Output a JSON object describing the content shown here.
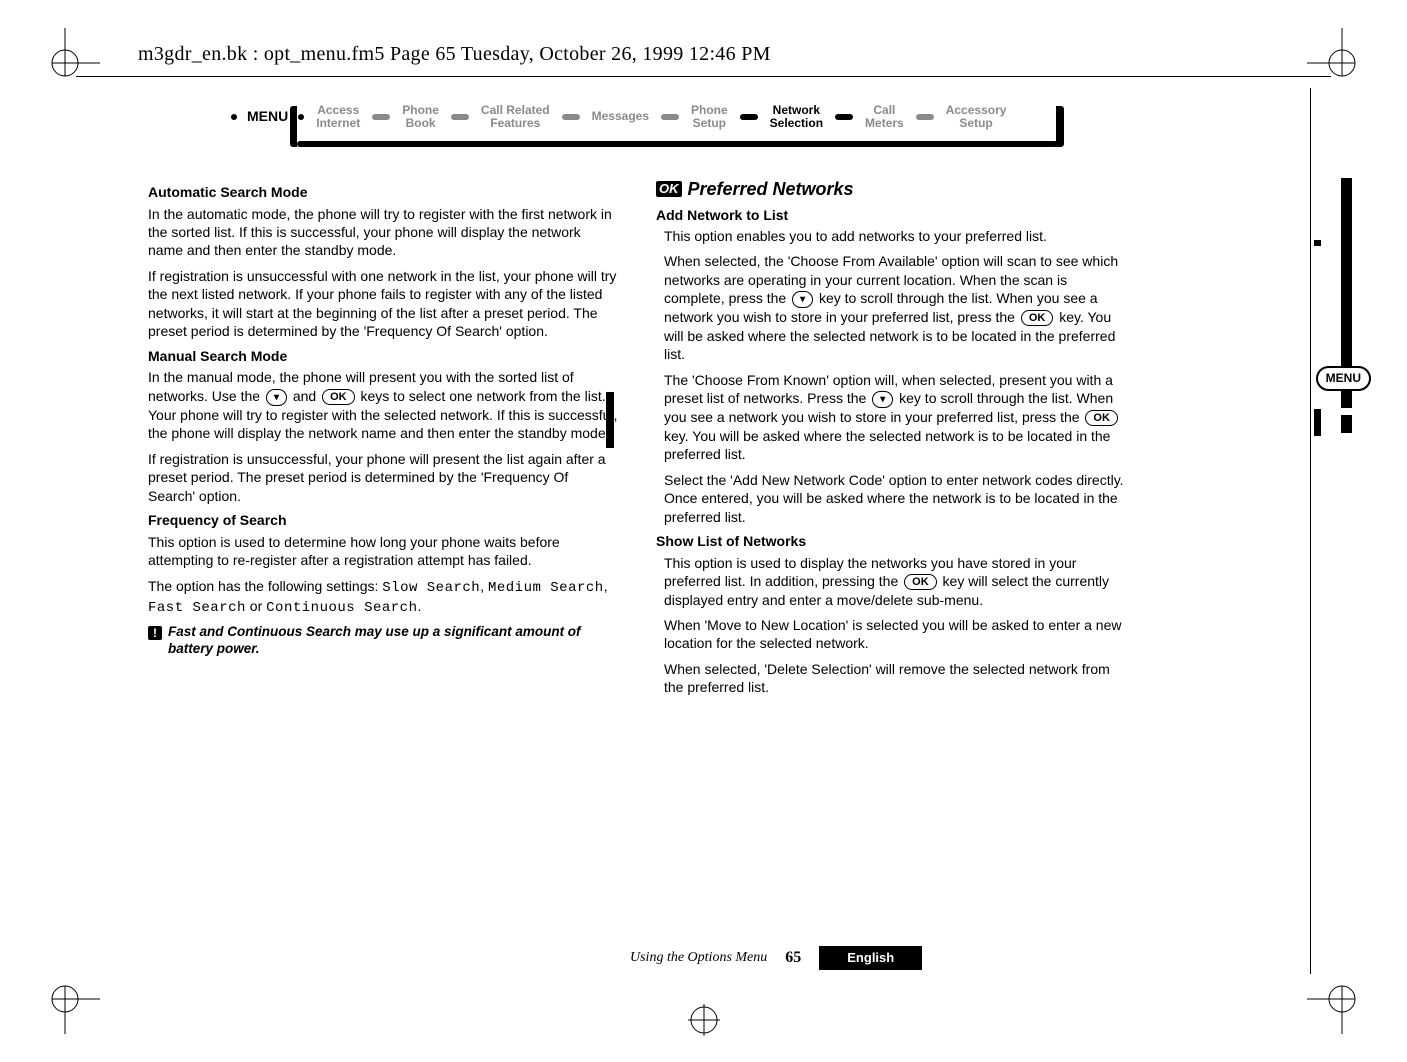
{
  "print_header": "m3gdr_en.bk : opt_menu.fm5  Page 65  Tuesday, October 26, 1999  12:46 PM",
  "nav": {
    "menu_label": "MENU",
    "items": [
      {
        "top": "Access",
        "bot": "Internet"
      },
      {
        "top": "Phone",
        "bot": "Book"
      },
      {
        "top": "Call Related",
        "bot": "Features"
      },
      {
        "top": "Messages",
        "bot": ""
      },
      {
        "top": "Phone",
        "bot": "Setup"
      },
      {
        "top": "Network",
        "bot": "Selection"
      },
      {
        "top": "Call",
        "bot": "Meters"
      },
      {
        "top": "Accessory",
        "bot": "Setup"
      }
    ],
    "active_index": 5
  },
  "left": {
    "h_auto": "Automatic Search Mode",
    "auto_p1": "In the automatic mode, the phone will try to register with the first network in the sorted list. If this is successful, your phone will display the network name and then enter the standby mode.",
    "auto_p2": "If registration is unsuccessful with one network in the list, your phone will try the next listed network. If your phone fails to register with any of the listed networks, it will start at the beginning of the list after a preset period. The preset period is determined by the 'Frequency Of Search' option.",
    "h_manual": "Manual Search Mode",
    "manual_p1a": "In the manual mode, the phone will present you with the sorted list of networks. Use the ",
    "manual_p1b": " and ",
    "manual_p1c": " keys to select one network from the list. Your phone will try to register with the selected network. If this is successful, the phone will display the network name and then enter the standby mode.",
    "manual_p2": "If registration is unsuccessful, your phone will present the list again after a preset period. The preset period is determined by the 'Frequency Of Search' option.",
    "h_freq": "Frequency of Search",
    "freq_p1": "This option is used to determine how long your phone waits before attempting to re-register after a registration attempt has failed.",
    "freq_p2a": "The option has the following settings: ",
    "freq_slow": "Slow Search",
    "freq_sep1": ", ",
    "freq_med": "Medium Search",
    "freq_sep2": ", ",
    "freq_fast": "Fast Search",
    "freq_or": " or ",
    "freq_cont": "Continuous Search",
    "freq_end": ".",
    "note": "Fast and Continuous Search may use up a significant amount of battery power."
  },
  "right": {
    "ok_badge": "OK",
    "section_title": "Preferred Networks",
    "h_add": "Add Network to List",
    "add_p1": "This option enables you to add networks to your preferred list.",
    "add_p2a": "When selected, the 'Choose From Available' option will scan to see which networks are operating in your current location. When the scan is complete, press the ",
    "add_p2b": " key to scroll through the list. When you see a network you wish to store in your preferred list, press the ",
    "add_p2c": " key. You will be asked where the selected network is to be located in the preferred list.",
    "add_p3a": "The 'Choose From Known' option will, when selected, present you with a preset list of networks. Press the ",
    "add_p3b": " key to scroll through the list. When you see a network you wish to store in your preferred list, press the ",
    "add_p3c": " key. You will be asked where the selected network is to be located in the preferred list.",
    "add_p4": "Select the 'Add New Network Code' option to enter network codes directly. Once entered, you will be asked where the network is to be located in the preferred list.",
    "h_show": "Show List of Networks",
    "show_p1a": "This option is used to display the networks you have stored in your preferred list. In addition, pressing the ",
    "show_p1b": " key will select the currently displayed entry and enter a move/delete sub-menu.",
    "show_p2": "When 'Move to New Location' is selected you will be asked to enter a new location for the selected network.",
    "show_p3": "When selected, 'Delete Selection' will remove the selected network from the preferred list."
  },
  "keys": {
    "down_label": "",
    "ok_label": "OK"
  },
  "side_pill": "MENU",
  "footer": {
    "using": "Using the Options Menu",
    "page": "65",
    "lang": "English"
  }
}
